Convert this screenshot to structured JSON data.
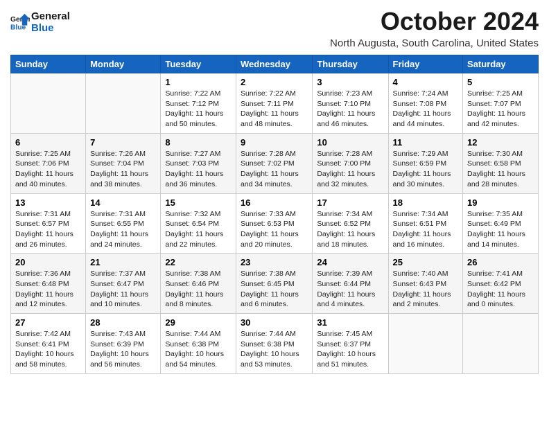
{
  "logo": {
    "line1": "General",
    "line2": "Blue"
  },
  "header": {
    "month": "October 2024",
    "location": "North Augusta, South Carolina, United States"
  },
  "weekdays": [
    "Sunday",
    "Monday",
    "Tuesday",
    "Wednesday",
    "Thursday",
    "Friday",
    "Saturday"
  ],
  "weeks": [
    [
      {
        "day": "",
        "sunrise": "",
        "sunset": "",
        "daylight": ""
      },
      {
        "day": "",
        "sunrise": "",
        "sunset": "",
        "daylight": ""
      },
      {
        "day": "1",
        "sunrise": "Sunrise: 7:22 AM",
        "sunset": "Sunset: 7:12 PM",
        "daylight": "Daylight: 11 hours and 50 minutes."
      },
      {
        "day": "2",
        "sunrise": "Sunrise: 7:22 AM",
        "sunset": "Sunset: 7:11 PM",
        "daylight": "Daylight: 11 hours and 48 minutes."
      },
      {
        "day": "3",
        "sunrise": "Sunrise: 7:23 AM",
        "sunset": "Sunset: 7:10 PM",
        "daylight": "Daylight: 11 hours and 46 minutes."
      },
      {
        "day": "4",
        "sunrise": "Sunrise: 7:24 AM",
        "sunset": "Sunset: 7:08 PM",
        "daylight": "Daylight: 11 hours and 44 minutes."
      },
      {
        "day": "5",
        "sunrise": "Sunrise: 7:25 AM",
        "sunset": "Sunset: 7:07 PM",
        "daylight": "Daylight: 11 hours and 42 minutes."
      }
    ],
    [
      {
        "day": "6",
        "sunrise": "Sunrise: 7:25 AM",
        "sunset": "Sunset: 7:06 PM",
        "daylight": "Daylight: 11 hours and 40 minutes."
      },
      {
        "day": "7",
        "sunrise": "Sunrise: 7:26 AM",
        "sunset": "Sunset: 7:04 PM",
        "daylight": "Daylight: 11 hours and 38 minutes."
      },
      {
        "day": "8",
        "sunrise": "Sunrise: 7:27 AM",
        "sunset": "Sunset: 7:03 PM",
        "daylight": "Daylight: 11 hours and 36 minutes."
      },
      {
        "day": "9",
        "sunrise": "Sunrise: 7:28 AM",
        "sunset": "Sunset: 7:02 PM",
        "daylight": "Daylight: 11 hours and 34 minutes."
      },
      {
        "day": "10",
        "sunrise": "Sunrise: 7:28 AM",
        "sunset": "Sunset: 7:00 PM",
        "daylight": "Daylight: 11 hours and 32 minutes."
      },
      {
        "day": "11",
        "sunrise": "Sunrise: 7:29 AM",
        "sunset": "Sunset: 6:59 PM",
        "daylight": "Daylight: 11 hours and 30 minutes."
      },
      {
        "day": "12",
        "sunrise": "Sunrise: 7:30 AM",
        "sunset": "Sunset: 6:58 PM",
        "daylight": "Daylight: 11 hours and 28 minutes."
      }
    ],
    [
      {
        "day": "13",
        "sunrise": "Sunrise: 7:31 AM",
        "sunset": "Sunset: 6:57 PM",
        "daylight": "Daylight: 11 hours and 26 minutes."
      },
      {
        "day": "14",
        "sunrise": "Sunrise: 7:31 AM",
        "sunset": "Sunset: 6:55 PM",
        "daylight": "Daylight: 11 hours and 24 minutes."
      },
      {
        "day": "15",
        "sunrise": "Sunrise: 7:32 AM",
        "sunset": "Sunset: 6:54 PM",
        "daylight": "Daylight: 11 hours and 22 minutes."
      },
      {
        "day": "16",
        "sunrise": "Sunrise: 7:33 AM",
        "sunset": "Sunset: 6:53 PM",
        "daylight": "Daylight: 11 hours and 20 minutes."
      },
      {
        "day": "17",
        "sunrise": "Sunrise: 7:34 AM",
        "sunset": "Sunset: 6:52 PM",
        "daylight": "Daylight: 11 hours and 18 minutes."
      },
      {
        "day": "18",
        "sunrise": "Sunrise: 7:34 AM",
        "sunset": "Sunset: 6:51 PM",
        "daylight": "Daylight: 11 hours and 16 minutes."
      },
      {
        "day": "19",
        "sunrise": "Sunrise: 7:35 AM",
        "sunset": "Sunset: 6:49 PM",
        "daylight": "Daylight: 11 hours and 14 minutes."
      }
    ],
    [
      {
        "day": "20",
        "sunrise": "Sunrise: 7:36 AM",
        "sunset": "Sunset: 6:48 PM",
        "daylight": "Daylight: 11 hours and 12 minutes."
      },
      {
        "day": "21",
        "sunrise": "Sunrise: 7:37 AM",
        "sunset": "Sunset: 6:47 PM",
        "daylight": "Daylight: 11 hours and 10 minutes."
      },
      {
        "day": "22",
        "sunrise": "Sunrise: 7:38 AM",
        "sunset": "Sunset: 6:46 PM",
        "daylight": "Daylight: 11 hours and 8 minutes."
      },
      {
        "day": "23",
        "sunrise": "Sunrise: 7:38 AM",
        "sunset": "Sunset: 6:45 PM",
        "daylight": "Daylight: 11 hours and 6 minutes."
      },
      {
        "day": "24",
        "sunrise": "Sunrise: 7:39 AM",
        "sunset": "Sunset: 6:44 PM",
        "daylight": "Daylight: 11 hours and 4 minutes."
      },
      {
        "day": "25",
        "sunrise": "Sunrise: 7:40 AM",
        "sunset": "Sunset: 6:43 PM",
        "daylight": "Daylight: 11 hours and 2 minutes."
      },
      {
        "day": "26",
        "sunrise": "Sunrise: 7:41 AM",
        "sunset": "Sunset: 6:42 PM",
        "daylight": "Daylight: 11 hours and 0 minutes."
      }
    ],
    [
      {
        "day": "27",
        "sunrise": "Sunrise: 7:42 AM",
        "sunset": "Sunset: 6:41 PM",
        "daylight": "Daylight: 10 hours and 58 minutes."
      },
      {
        "day": "28",
        "sunrise": "Sunrise: 7:43 AM",
        "sunset": "Sunset: 6:39 PM",
        "daylight": "Daylight: 10 hours and 56 minutes."
      },
      {
        "day": "29",
        "sunrise": "Sunrise: 7:44 AM",
        "sunset": "Sunset: 6:38 PM",
        "daylight": "Daylight: 10 hours and 54 minutes."
      },
      {
        "day": "30",
        "sunrise": "Sunrise: 7:44 AM",
        "sunset": "Sunset: 6:38 PM",
        "daylight": "Daylight: 10 hours and 53 minutes."
      },
      {
        "day": "31",
        "sunrise": "Sunrise: 7:45 AM",
        "sunset": "Sunset: 6:37 PM",
        "daylight": "Daylight: 10 hours and 51 minutes."
      },
      {
        "day": "",
        "sunrise": "",
        "sunset": "",
        "daylight": ""
      },
      {
        "day": "",
        "sunrise": "",
        "sunset": "",
        "daylight": ""
      }
    ]
  ]
}
